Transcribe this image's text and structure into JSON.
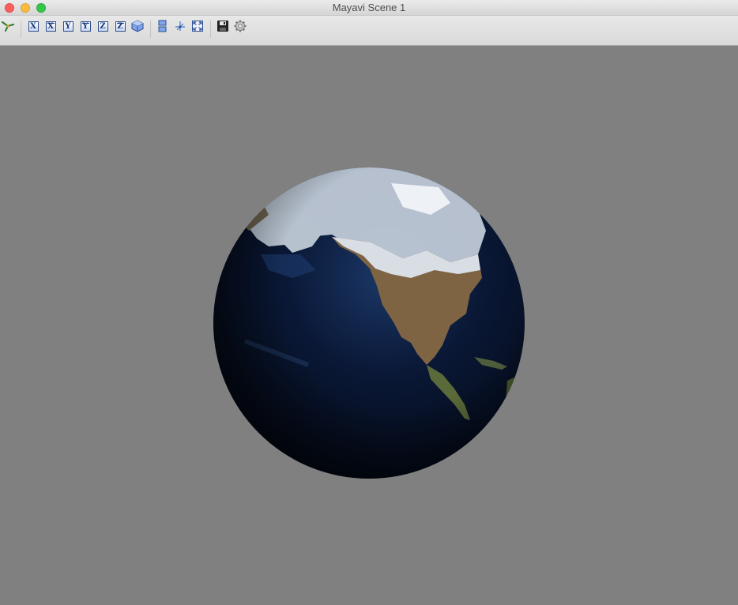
{
  "window": {
    "title": "Mayavi Scene 1"
  },
  "toolbar": {
    "buttons": [
      {
        "id": "mayavi-icon"
      },
      {
        "label": "X",
        "view": "+x"
      },
      {
        "label": "X",
        "view": "-x"
      },
      {
        "label": "Y",
        "view": "+y"
      },
      {
        "label": "Y",
        "view": "-y"
      },
      {
        "label": "Z",
        "view": "+z"
      },
      {
        "label": "Z",
        "view": "-z"
      },
      {
        "id": "isometric-icon"
      },
      {
        "id": "parallel-projection-icon"
      },
      {
        "id": "axes-indicator-icon"
      },
      {
        "id": "full-screen-icon"
      },
      {
        "id": "save-icon"
      },
      {
        "id": "configure-icon"
      }
    ]
  },
  "colors": {
    "scene_background": "#808080",
    "ocean": "#07132b",
    "land": "#8a6b45",
    "snow": "#dfe6ee"
  }
}
